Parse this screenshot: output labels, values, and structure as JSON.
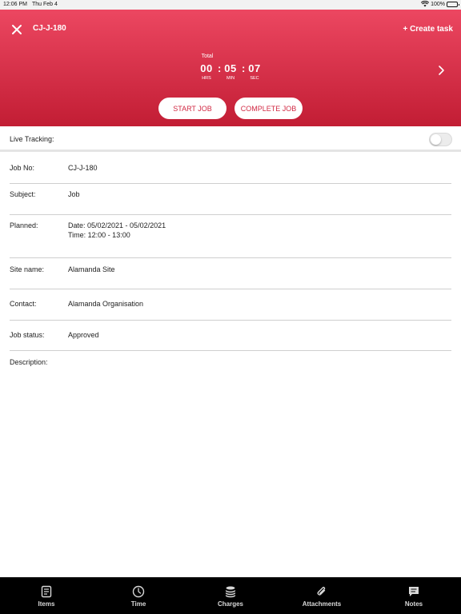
{
  "status_bar": {
    "time": "12:06 PM",
    "date": "Thu Feb 4",
    "battery": "100%"
  },
  "header": {
    "title": "CJ-J-180",
    "create_task": "+ Create task",
    "timer": {
      "label": "Total",
      "hours": "00",
      "minutes": "05",
      "seconds": "07",
      "hours_label": "HRS",
      "minutes_label": "MIN",
      "seconds_label": "SEC",
      "separator": ":"
    },
    "start_button": "START JOB",
    "complete_button": "COMPLETE JOB"
  },
  "live_tracking": {
    "label": "Live Tracking:",
    "enabled": false
  },
  "details": [
    {
      "label": "Job No:",
      "value": "CJ-J-180"
    },
    {
      "label": "Subject:",
      "value": "Job"
    },
    {
      "label": "Planned:",
      "value": "Date: 05/02/2021 - 05/02/2021",
      "value2": "Time: 12:00 - 13:00"
    },
    {
      "label": "Site name:",
      "value": "Alamanda Site"
    },
    {
      "label": "Contact:",
      "value": "Alamanda Organisation"
    },
    {
      "label": "Job status:",
      "value": "Approved"
    },
    {
      "label": "Description:",
      "value": ""
    }
  ],
  "tabs": [
    {
      "label": "Items",
      "icon": "items-icon"
    },
    {
      "label": "Time",
      "icon": "clock-icon"
    },
    {
      "label": "Charges",
      "icon": "coins-icon"
    },
    {
      "label": "Attachments",
      "icon": "paperclip-icon"
    },
    {
      "label": "Notes",
      "icon": "notes-icon"
    }
  ],
  "colors": {
    "accent_top": "#ec4761",
    "accent_bottom": "#c21d34",
    "tabbar": "#000000"
  }
}
